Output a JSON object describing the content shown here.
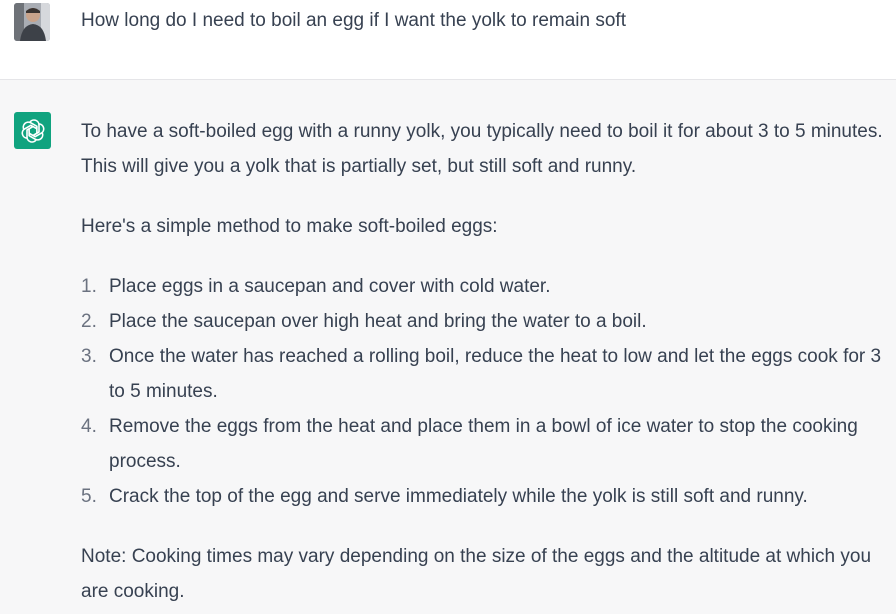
{
  "user_message": {
    "avatar": "user-avatar-photo",
    "text": "How long do I need to boil an egg if I want the yolk to remain soft"
  },
  "assistant_message": {
    "icon": "openai-logo-icon",
    "icon_color": "#10a37f",
    "intro": "To have a soft-boiled egg with a runny yolk, you typically need to boil it for about 3 to 5 minutes. This will give you a yolk that is partially set, but still soft and runny.",
    "method_heading": "Here's a simple method to make soft-boiled eggs:",
    "steps": [
      {
        "num": "1.",
        "text": "Place eggs in a saucepan and cover with cold water."
      },
      {
        "num": "2.",
        "text": "Place the saucepan over high heat and bring the water to a boil."
      },
      {
        "num": "3.",
        "text": "Once the water has reached a rolling boil, reduce the heat to low and let the eggs cook for 3 to 5 minutes."
      },
      {
        "num": "4.",
        "text": "Remove the eggs from the heat and place them in a bowl of ice water to stop the cooking process."
      },
      {
        "num": "5.",
        "text": "Crack the top of the egg and serve immediately while the yolk is still soft and runny."
      }
    ],
    "note": "Note: Cooking times may vary depending on the size of the eggs and the altitude at which you are cooking."
  }
}
